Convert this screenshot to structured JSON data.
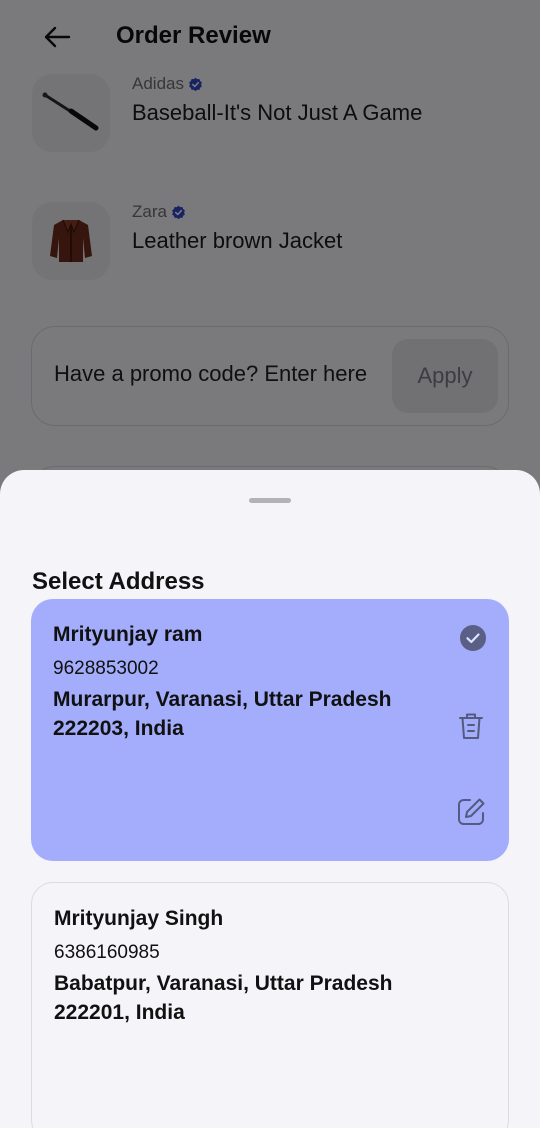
{
  "header": {
    "title": "Order Review",
    "back_icon": "arrow-left-icon"
  },
  "products": [
    {
      "brand": "Adidas",
      "name": "Baseball-It's Not Just A Game",
      "image": "baseball-bat-image"
    },
    {
      "brand": "Zara",
      "name": "Leather brown Jacket",
      "image": "leather-jacket-image"
    }
  ],
  "promo": {
    "placeholder": "Have a promo code? Enter here",
    "apply_label": "Apply"
  },
  "sheet": {
    "title": "Select Address",
    "addresses": [
      {
        "name": "Mrityunjay ram",
        "phone": "9628853002",
        "address": "Murarpur, Varanasi, Uttar Pradesh 222203, India",
        "selected": true
      },
      {
        "name": "Mrityunjay Singh",
        "phone": "6386160985",
        "address": "Babatpur, Varanasi, Uttar Pradesh 222201, India",
        "selected": false
      }
    ]
  },
  "colors": {
    "selected_card": "#a3adfb",
    "verified_badge": "#3346c9",
    "check_fill": "#5a5f86"
  }
}
